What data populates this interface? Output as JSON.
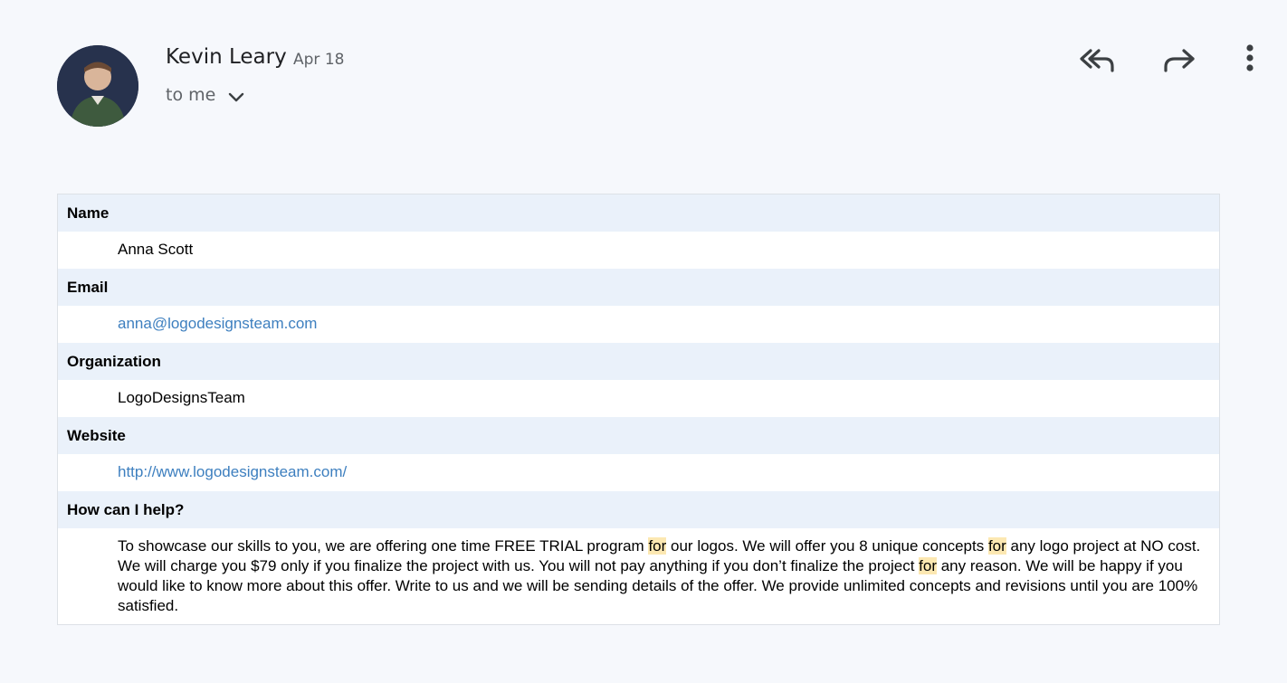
{
  "email": {
    "sender_name": "Kevin Leary",
    "date": "Apr 18",
    "recipient_line": "to me",
    "actions": {
      "reply_all_icon": "reply-all-icon",
      "forward_icon": "forward-icon",
      "more_icon": "more-vert-icon"
    }
  },
  "form": {
    "fields": [
      {
        "label": "Name",
        "value": "Anna Scott"
      },
      {
        "label": "Email",
        "value": "anna@logodesignsteam.com"
      },
      {
        "label": "Organization",
        "value": "LogoDesignsTeam"
      },
      {
        "label": "Website",
        "value": "http://www.logodesignsteam.com/"
      },
      {
        "label": "How can I help?"
      }
    ],
    "message_parts": [
      "To showcase our skills to you, we are offering one time FREE TRIAL program ",
      "for",
      " our logos. We will offer you 8 unique concepts ",
      "for",
      " any logo project at NO cost. We will charge you $79 only if you finalize the project with us. You will not pay anything if you don’t finalize the project ",
      "for",
      " any reason. We will be happy if you would like to know more about this offer. Write to us and we will be sending details of the offer. We provide unlimited concepts and revisions until you are 100% satisfied."
    ]
  },
  "colors": {
    "background": "#f6f8fc",
    "label_row": "#eaf1fa",
    "link": "#3d7fbf",
    "highlight": "#fce8b2"
  }
}
